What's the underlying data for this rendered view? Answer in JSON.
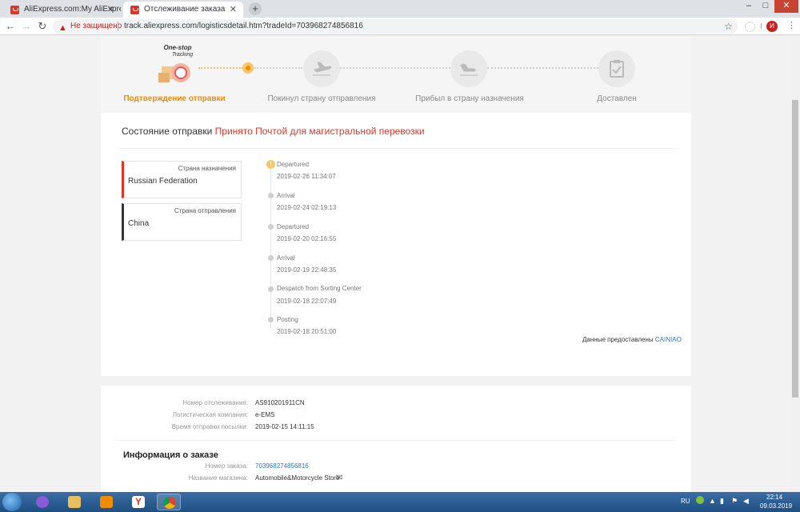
{
  "browser": {
    "tabs": [
      {
        "title": "AliExpress.com:My AliExpress",
        "active": false
      },
      {
        "title": "Отслеживание заказа",
        "active": true
      }
    ],
    "security_label": "Не защищено",
    "url": "track.aliexpress.com/logisticsdetail.htm?tradeId=703968274856816",
    "profile_initial": "И"
  },
  "progress": {
    "steps": [
      {
        "label": "Подтверждение отправки",
        "state": "current"
      },
      {
        "label": "Покинул страну отправления",
        "state": "pending"
      },
      {
        "label": "Прибыл в страну назначения",
        "state": "pending"
      },
      {
        "label": "Доставлен",
        "state": "pending"
      }
    ],
    "badge_line1": "One-stop",
    "badge_line2": "Tracking"
  },
  "status": {
    "label": "Состояние отправки",
    "value": "Принято Почтой для магистральной перевозки"
  },
  "countries": [
    {
      "caption": "Страна назначения",
      "name": "Russian Federation",
      "accent": "#e43225"
    },
    {
      "caption": "Страна отправления",
      "name": "China",
      "accent": "#333333"
    }
  ],
  "timeline": [
    {
      "event": "Departured",
      "time": "2019-02-26 11:34:07",
      "active": true
    },
    {
      "event": "Arrival",
      "time": "2019-02-24 02:19:13",
      "active": false
    },
    {
      "event": "Departured",
      "time": "2019-02-20 02:16:55",
      "active": false
    },
    {
      "event": "Arrival",
      "time": "2019-02-19 22:48:35",
      "active": false
    },
    {
      "event": "Despatch from Sorting Center",
      "time": "2019-02-18 22:07:49",
      "active": false
    },
    {
      "event": "Posting",
      "time": "2019-02-18 20:51:00",
      "active": false
    }
  ],
  "provided_by": {
    "text": "Данные предоставлены",
    "link": "CAINIAO"
  },
  "shipment": [
    {
      "key": "Номер отслеживания:",
      "value": "AS910201911CN"
    },
    {
      "key": "Логистическая компания:",
      "value": "e-EMS"
    },
    {
      "key": "Время отправки посылки:",
      "value": "2019-02-15 14:11:15"
    }
  ],
  "order": {
    "title": "Информация о заказе",
    "rows": [
      {
        "key": "Номер заказа:",
        "value": "703968274856816",
        "link": true
      },
      {
        "key": "Название магазина:",
        "value": "Automobile&Motorcycle Store",
        "link": false
      }
    ]
  },
  "taskbar": {
    "lang": "RU",
    "time": "22:14",
    "date": "09.03.2019"
  },
  "colors": {
    "accent_orange": "#f08c00",
    "status_red": "#e43225",
    "link_blue": "#2a7ab8"
  }
}
